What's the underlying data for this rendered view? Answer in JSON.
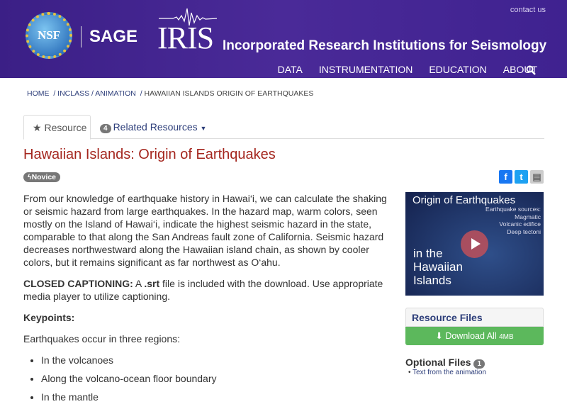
{
  "header": {
    "contact": "contact us",
    "nsf_logo": "NSF",
    "sage_logo": "SAGE",
    "iris_logo": "IRIS",
    "org_name": "Incorporated Research Institutions for Seismology",
    "nav": [
      "DATA",
      "INSTRUMENTATION",
      "EDUCATION",
      "ABOUT"
    ]
  },
  "breadcrumb": [
    "HOME",
    "INCLASS",
    "ANIMATION",
    "HAWAIIAN ISLANDS ORIGIN OF EARTHQUAKES"
  ],
  "tabs": {
    "resource": "Resource",
    "related_count": "4",
    "related": "Related Resources"
  },
  "title": "Hawaiian Islands: Origin of Earthquakes",
  "level": "Novice",
  "body": {
    "intro": "From our knowledge of earthquake history in Hawai‘i, we can calculate the shaking or seismic hazard from large earthquakes. In the hazard map, warm colors, seen mostly on the Island of Hawai‘i, indicate the highest seismic hazard in the state, comparable to that along the San Andreas fault zone of California. Seismic hazard decreases northwestward along the Hawaiian island chain, as shown by cooler colors, but it remains significant as far northwest as O‘ahu.",
    "cc_label": "CLOSED CAPTIONING:",
    "cc_a": " A ",
    "cc_srt": ".srt",
    "cc_rest": " file is included with the download. Use appropriate media player to utilize captioning.",
    "keypoints": "Keypoints:",
    "regions_intro": "Earthquakes occur in three regions:",
    "regions": [
      "In the volcanoes",
      "Along the volcano-ocean floor boundary",
      "In the mantle"
    ]
  },
  "video": {
    "title": "Origin of Earthquakes",
    "sources_label": "Earthquake sources:",
    "sources": [
      "Magmatic",
      "Volcanic edifice",
      "Deep tectoni"
    ],
    "subtitle": [
      "in the",
      "Hawaiian",
      "Islands"
    ]
  },
  "resource_files": {
    "heading": "Resource Files",
    "download": "Download All",
    "size": "4MB"
  },
  "optional_files": {
    "heading": "Optional Files",
    "count": "1",
    "items": [
      "Text from the animation"
    ]
  }
}
